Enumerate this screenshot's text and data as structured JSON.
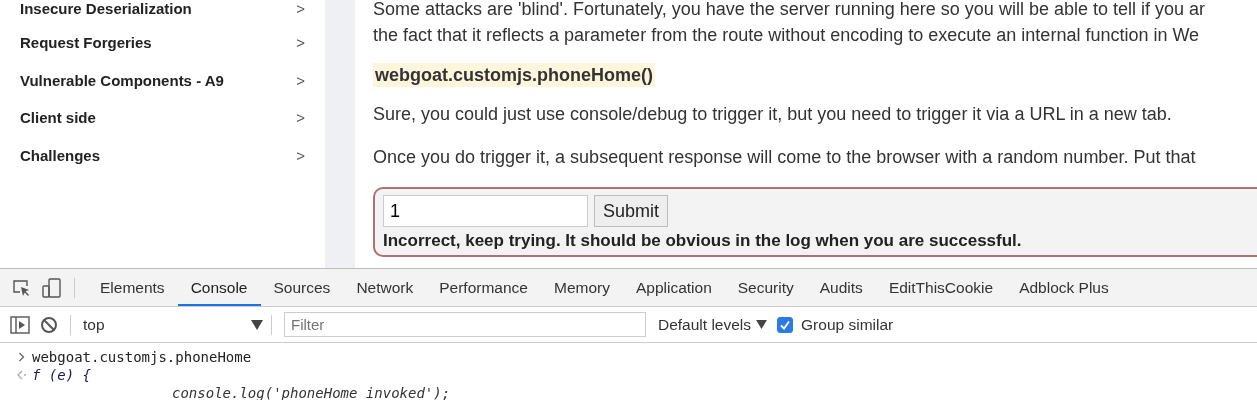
{
  "sidebar": {
    "items": [
      {
        "label": "Insecure Deserialization",
        "chevron": ">"
      },
      {
        "label": "Request Forgeries",
        "chevron": ">"
      },
      {
        "label": "Vulnerable Components - A9",
        "chevron": ">"
      },
      {
        "label": "Client side",
        "chevron": ">"
      },
      {
        "label": "Challenges",
        "chevron": ">"
      }
    ]
  },
  "lesson": {
    "paragraphs": [
      {
        "kind": "text",
        "lines": [
          "Some attacks are 'blind'. Fortunately, you have the server running here so you will be able to tell if you ar",
          "the fact that it reflects a parameter from the route without encoding to execute an internal function in We"
        ]
      },
      {
        "kind": "code",
        "lines": [
          "webgoat.customjs.phoneHome()"
        ]
      },
      {
        "kind": "text",
        "lines": [
          "Sure, you could just use console/debug to trigger it, but you need to trigger it via a URL in a new tab."
        ]
      },
      {
        "kind": "text",
        "lines": [
          "Once you do trigger it, a subsequent response will come to the browser with a random number. Put that"
        ]
      }
    ],
    "form": {
      "value": "1",
      "button": "Submit",
      "feedback": "Incorrect, keep trying. It should be obvious in the log when you are successful."
    }
  },
  "devtools": {
    "tabs": [
      {
        "label": "Elements",
        "selected": false
      },
      {
        "label": "Console",
        "selected": true
      },
      {
        "label": "Sources",
        "selected": false
      },
      {
        "label": "Network",
        "selected": false
      },
      {
        "label": "Performance",
        "selected": false
      },
      {
        "label": "Memory",
        "selected": false
      },
      {
        "label": "Application",
        "selected": false
      },
      {
        "label": "Security",
        "selected": false
      },
      {
        "label": "Audits",
        "selected": false
      },
      {
        "label": "EditThisCookie",
        "selected": false
      },
      {
        "label": "Adblock Plus",
        "selected": false
      }
    ],
    "context": "top",
    "filter": {
      "placeholder": "Filter"
    },
    "levels": "Default levels",
    "group_similar": {
      "label": "Group similar",
      "checked": true
    },
    "console": [
      {
        "kind": "input",
        "text": "webgoat.customjs.phoneHome"
      },
      {
        "kind": "result",
        "text": "f (e) {"
      },
      {
        "kind": "body",
        "text": "console.log('phoneHome invoked');"
      }
    ]
  }
}
